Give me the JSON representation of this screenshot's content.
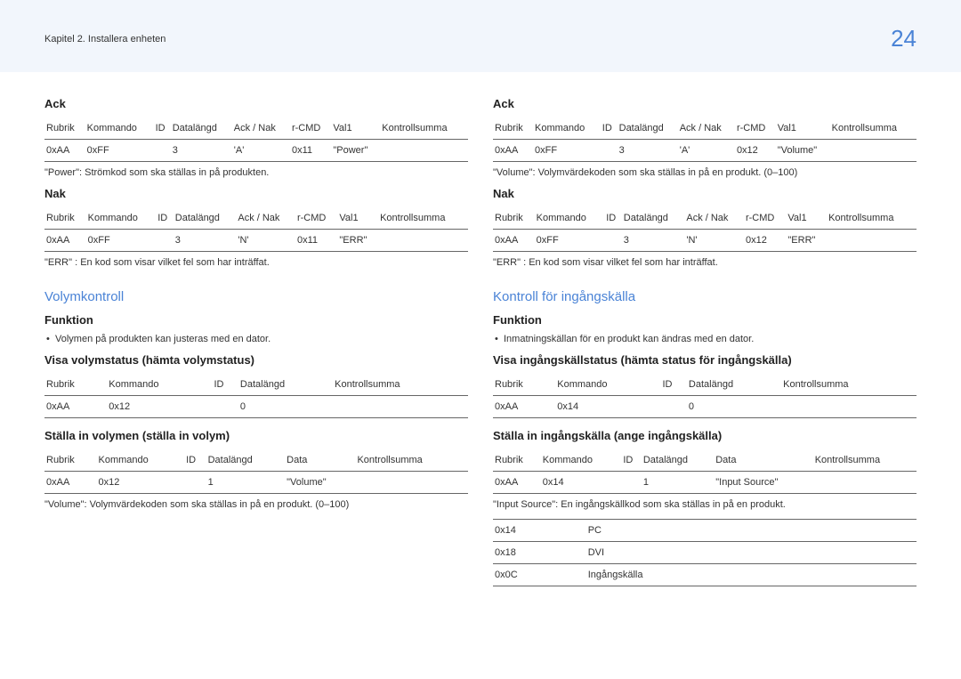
{
  "header": {
    "chapter": "Kapitel 2. Installera enheten",
    "page": "24"
  },
  "left": {
    "ack_title": "Ack",
    "table_headers_full": [
      "Rubrik",
      "Kommando",
      "ID",
      "Datalängd",
      "Ack / Nak",
      "r-CMD",
      "Val1",
      "Kontrollsumma"
    ],
    "ack_row": [
      "0xAA",
      "0xFF",
      "",
      "3",
      "'A'",
      "0x11",
      "\"Power\"",
      ""
    ],
    "ack_note": "\"Power\": Strömkod som ska ställas in på produkten.",
    "nak_title": "Nak",
    "nak_row": [
      "0xAA",
      "0xFF",
      "",
      "3",
      "'N'",
      "0x11",
      "\"ERR\"",
      ""
    ],
    "nak_note": "\"ERR\" : En kod som visar vilket fel som har inträffat.",
    "section": "Volymkontroll",
    "func_title": "Funktion",
    "func_bullet": "Volymen på produkten kan justeras med en dator.",
    "s1_title": "Visa volymstatus (hämta volymstatus)",
    "s1_headers": [
      "Rubrik",
      "Kommando",
      "ID",
      "Datalängd",
      "Kontrollsumma"
    ],
    "s1_row": [
      "0xAA",
      "0x12",
      "",
      "0",
      ""
    ],
    "s2_title": "Ställa in volymen (ställa in volym)",
    "s2_headers": [
      "Rubrik",
      "Kommando",
      "ID",
      "Datalängd",
      "Data",
      "Kontrollsumma"
    ],
    "s2_row": [
      "0xAA",
      "0x12",
      "",
      "1",
      "\"Volume\"",
      ""
    ],
    "s2_note": "\"Volume\": Volymvärdekoden som ska ställas in på en produkt. (0–100)"
  },
  "right": {
    "ack_title": "Ack",
    "table_headers_full": [
      "Rubrik",
      "Kommando",
      "ID",
      "Datalängd",
      "Ack / Nak",
      "r-CMD",
      "Val1",
      "Kontrollsumma"
    ],
    "ack_row": [
      "0xAA",
      "0xFF",
      "",
      "3",
      "'A'",
      "0x12",
      "\"Volume\"",
      ""
    ],
    "ack_note": "\"Volume\": Volymvärdekoden som ska ställas in på en produkt. (0–100)",
    "nak_title": "Nak",
    "nak_row": [
      "0xAA",
      "0xFF",
      "",
      "3",
      "'N'",
      "0x12",
      "\"ERR\"",
      ""
    ],
    "nak_note": "\"ERR\" : En kod som visar vilket fel som har inträffat.",
    "section": "Kontroll för ingångskälla",
    "func_title": "Funktion",
    "func_bullet": "Inmatningskällan för en produkt kan ändras med en dator.",
    "s1_title": "Visa ingångskällstatus (hämta status för ingångskälla)",
    "s1_headers": [
      "Rubrik",
      "Kommando",
      "ID",
      "Datalängd",
      "Kontrollsumma"
    ],
    "s1_row": [
      "0xAA",
      "0x14",
      "",
      "0",
      ""
    ],
    "s2_title": "Ställa in ingångskälla (ange ingångskälla)",
    "s2_headers": [
      "Rubrik",
      "Kommando",
      "ID",
      "Datalängd",
      "Data",
      "Kontrollsumma"
    ],
    "s2_row": [
      "0xAA",
      "0x14",
      "",
      "1",
      "\"Input Source\"",
      ""
    ],
    "s2_note": "\"Input Source\": En ingångskällkod som ska ställas in på en produkt.",
    "codes": [
      [
        "0x14",
        "PC"
      ],
      [
        "0x18",
        "DVI"
      ],
      [
        "0x0C",
        "Ingångskälla"
      ]
    ]
  }
}
